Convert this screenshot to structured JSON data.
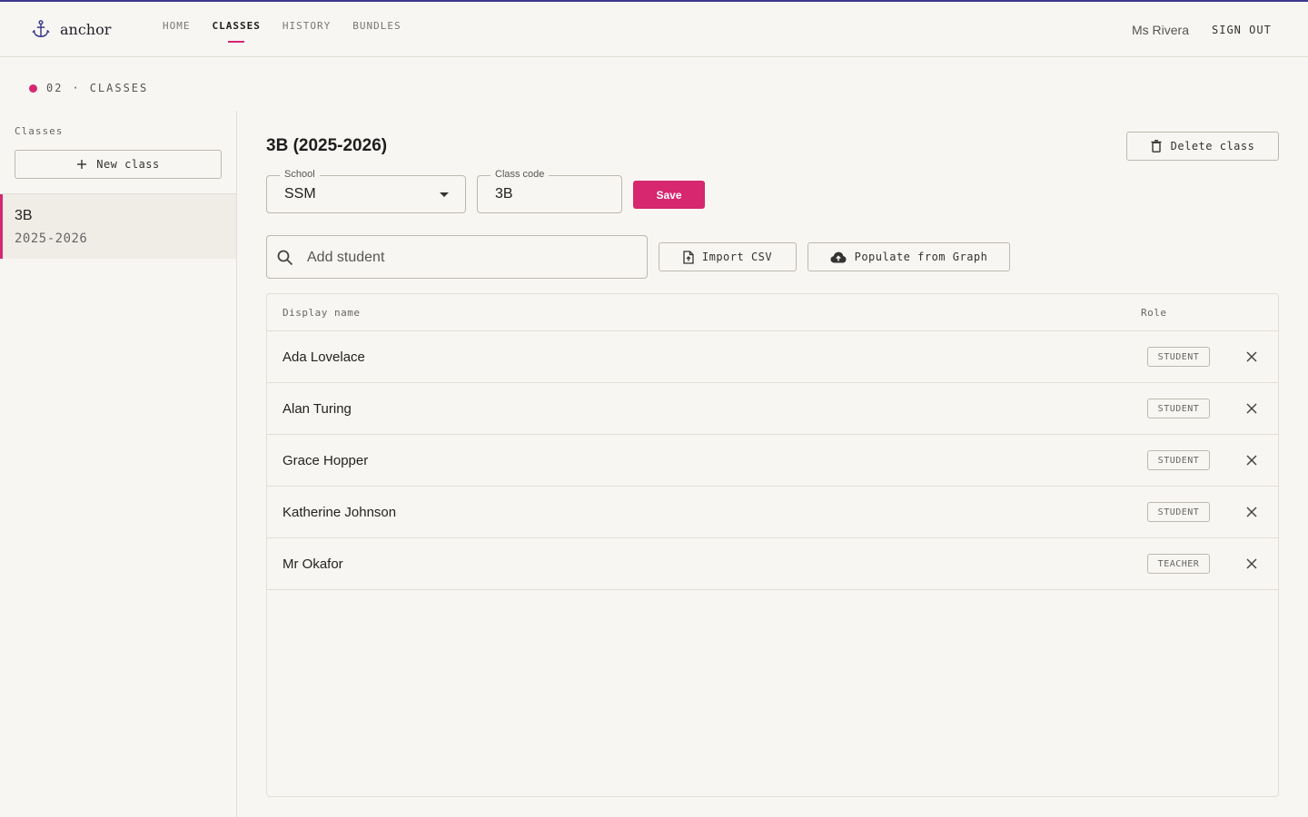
{
  "header": {
    "brand": "anchor",
    "nav": [
      {
        "label": "HOME"
      },
      {
        "label": "CLASSES"
      },
      {
        "label": "HISTORY"
      },
      {
        "label": "BUNDLES"
      }
    ],
    "active_nav": "CLASSES",
    "user_name": "Ms Rivera",
    "sign_out": "SIGN OUT"
  },
  "crumb": {
    "number": "02",
    "separator": "·",
    "section": "CLASSES"
  },
  "sidebar": {
    "title": "Classes",
    "new_class_label": "New class",
    "classes": [
      {
        "code": "3B",
        "year": "2025-2026"
      }
    ]
  },
  "main": {
    "title": "3B (2025-2026)",
    "delete_label": "Delete class",
    "school": {
      "label": "School",
      "value": "SSM"
    },
    "class_code": {
      "label": "Class code",
      "value": "3B"
    },
    "save_label": "Save",
    "search_placeholder": "Add student",
    "import_label": "Import CSV",
    "populate_label": "Populate from Graph",
    "table": {
      "columns": {
        "name": "Display name",
        "role": "Role"
      },
      "rows": [
        {
          "name": "Ada Lovelace",
          "role": "STUDENT"
        },
        {
          "name": "Alan Turing",
          "role": "STUDENT"
        },
        {
          "name": "Grace Hopper",
          "role": "STUDENT"
        },
        {
          "name": "Katherine Johnson",
          "role": "STUDENT"
        },
        {
          "name": "Mr Okafor",
          "role": "TEACHER"
        }
      ]
    }
  },
  "colors": {
    "accent": "#d6276f",
    "brand_line": "#3b3a8c",
    "background": "#f8f6f2"
  },
  "icons": {
    "brand": "anchor-icon",
    "new_class": "plus-icon",
    "delete": "trash-icon",
    "select": "chevron-down-icon",
    "search": "search-icon",
    "import": "file-upload-icon",
    "populate": "cloud-upload-icon",
    "remove": "close-icon"
  }
}
